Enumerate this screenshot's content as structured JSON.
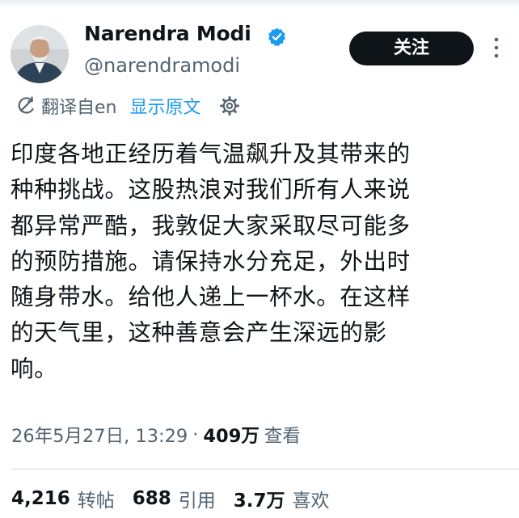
{
  "colors": {
    "accent": "#1d9bf0",
    "text_primary": "#0f1419",
    "text_secondary": "#536471",
    "button_bg": "#0f1419",
    "divider": "#cfd9de"
  },
  "author": {
    "avatar_icon": "avatar-photo",
    "display_name": "Narendra Modi",
    "verified_icon": "verified-badge-icon",
    "handle": "@narendramodi",
    "follow_label": "关注",
    "more_icon": "more-vertical-icon"
  },
  "translation": {
    "icon": "translate-icon",
    "translated_from": "翻译自en",
    "show_original": "显示原文",
    "settings_icon": "gear-icon"
  },
  "tweet": {
    "lines": [
      "印度各地正经历着气温飙升及其带来的",
      "种种挑战。这股热浪对我们所有人来说",
      "都异常严酷，我敦促大家采取尽可能多",
      "的预防措施。请保持水分充足，外出时",
      "随身带水。给他人递上一杯水。在这样",
      "的天气里，这种善意会产生深远的影",
      "响。"
    ]
  },
  "meta": {
    "timestamp": "26年5月27日, 13:29",
    "separator": "·",
    "views_count": "409万",
    "views_label": "查看"
  },
  "stats": [
    {
      "count": "4,216",
      "label": "转帖"
    },
    {
      "count": "688",
      "label": "引用"
    },
    {
      "count": "3.7万",
      "label": "喜欢"
    }
  ]
}
